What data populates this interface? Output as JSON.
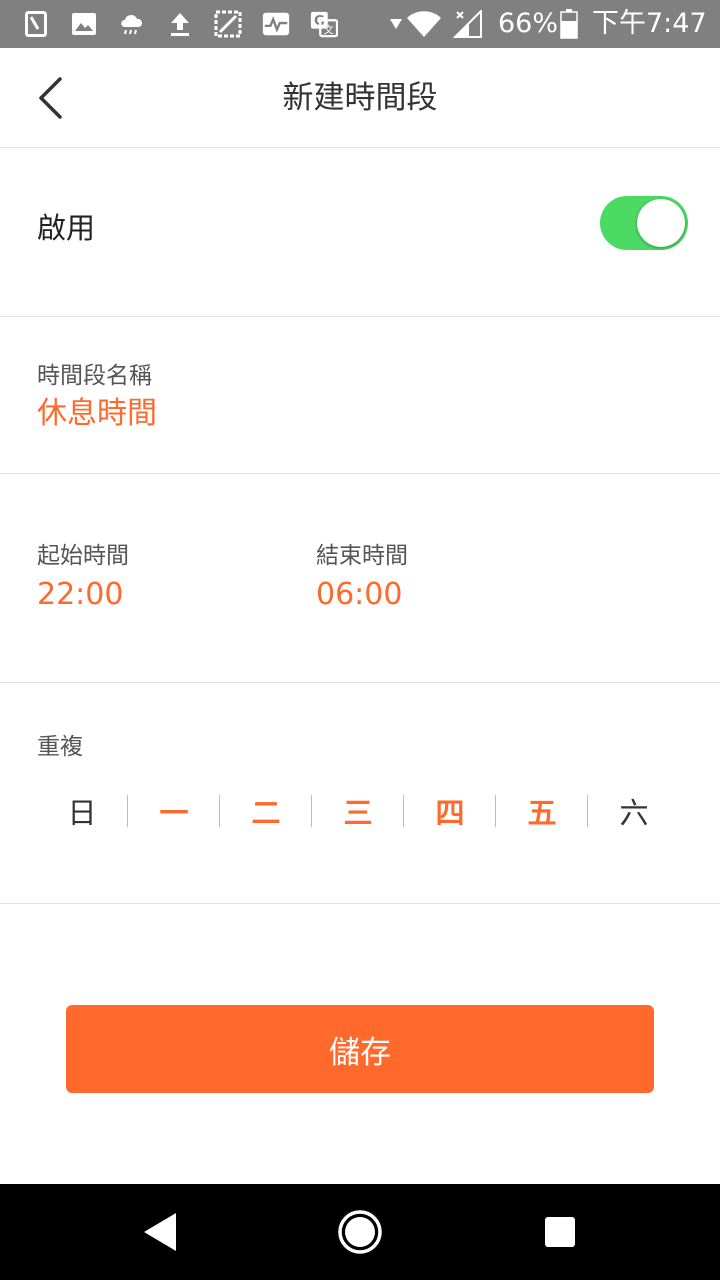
{
  "status_bar": {
    "battery_percent": "66%",
    "time": "下午7:47",
    "icons": [
      "sim-icon",
      "image-icon",
      "cloud-rain-icon",
      "upload-icon",
      "crop-icon",
      "activity-icon",
      "translate-icon",
      "data-arrow-icon",
      "wifi-icon",
      "signal-icon",
      "battery-icon"
    ]
  },
  "header": {
    "title": "新建時間段",
    "back_icon": "chevron-left-icon"
  },
  "enable": {
    "label": "啟用",
    "enabled": true,
    "toggle_color": "#4cd964"
  },
  "name": {
    "label": "時間段名稱",
    "value": "休息時間"
  },
  "time": {
    "start_label": "起始時間",
    "start_value": "22:00",
    "end_label": "結束時間",
    "end_value": "06:00"
  },
  "repeat": {
    "label": "重複",
    "days": [
      {
        "label": "日",
        "selected": false
      },
      {
        "label": "一",
        "selected": true
      },
      {
        "label": "二",
        "selected": true
      },
      {
        "label": "三",
        "selected": true
      },
      {
        "label": "四",
        "selected": true
      },
      {
        "label": "五",
        "selected": true
      },
      {
        "label": "六",
        "selected": false
      }
    ]
  },
  "save_label": "儲存",
  "colors": {
    "accent": "#ff6a2c",
    "toggle_on": "#4cd964",
    "status_bar": "#808080"
  },
  "nav_bar": {
    "icons": [
      "back-triangle-icon",
      "home-circle-icon",
      "recents-square-icon"
    ]
  }
}
